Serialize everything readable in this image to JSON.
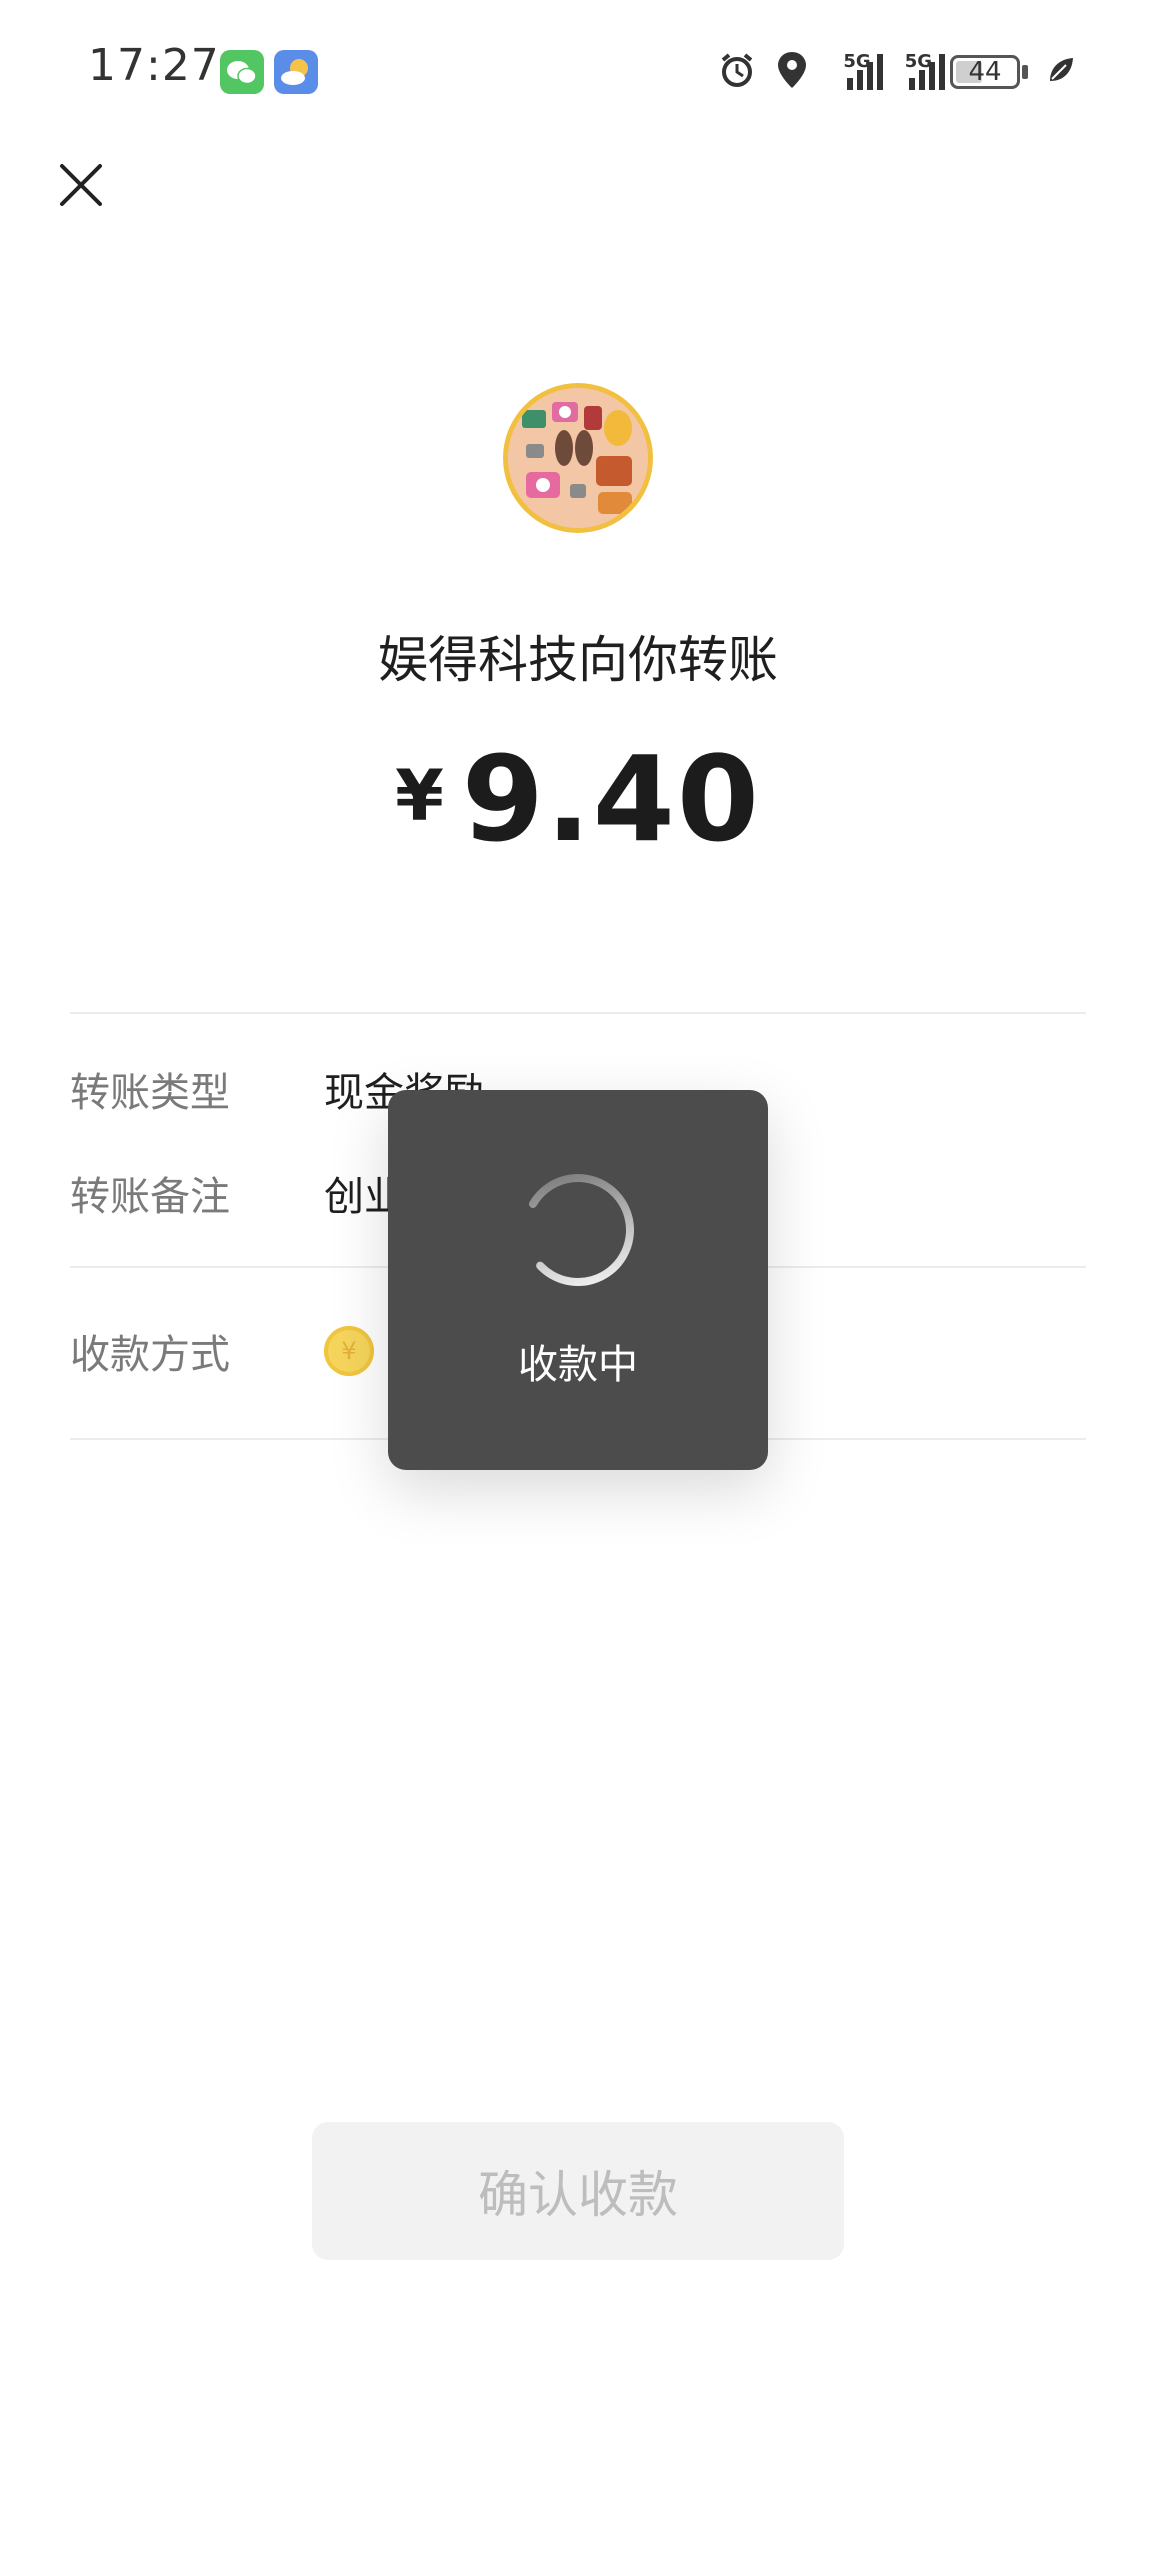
{
  "status_bar": {
    "time": "17:27",
    "network_1": "5G",
    "network_2": "5G",
    "battery": "44",
    "icons": [
      "wechat-icon",
      "weather-icon",
      "alarm-icon",
      "location-icon",
      "signal-icon",
      "leaf-icon"
    ]
  },
  "transfer": {
    "payer_title": "娱得科技向你转账",
    "currency": "¥",
    "amount": "9.40"
  },
  "details": {
    "type_label": "转账类型",
    "type_value": "现金奖励",
    "note_label": "转账备注",
    "note_value": "创业",
    "method_label": "收款方式"
  },
  "toast": {
    "text": "收款中"
  },
  "actions": {
    "confirm_label": "确认收款"
  },
  "colors": {
    "toast_bg": "#4c4c4c",
    "coin": "#f5d55c",
    "button_bg": "#f2f2f2",
    "button_text": "#bdbdbd"
  }
}
